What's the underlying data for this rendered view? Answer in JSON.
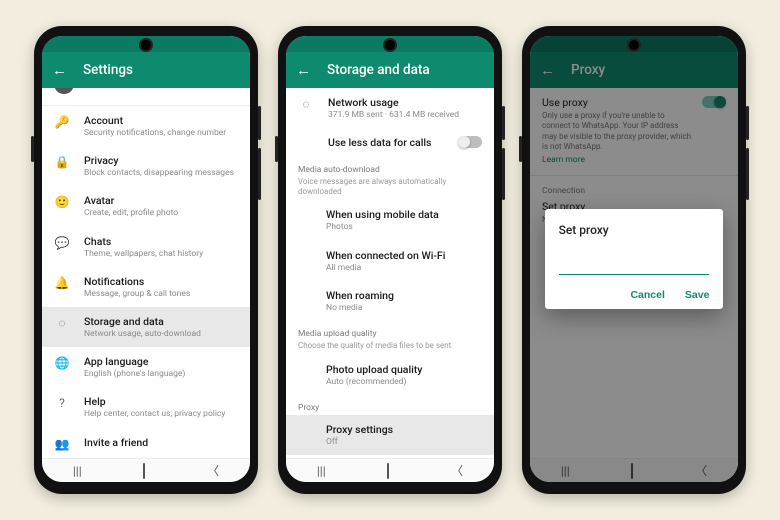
{
  "accent": "#0e8a6f",
  "phone1": {
    "title": "Settings",
    "items": [
      {
        "icon": "🔑",
        "label": "Account",
        "sub": "Security notifications, change number"
      },
      {
        "icon": "🔒",
        "label": "Privacy",
        "sub": "Block contacts, disappearing messages"
      },
      {
        "icon": "🙂",
        "label": "Avatar",
        "sub": "Create, edit, profile photo"
      },
      {
        "icon": "💬",
        "label": "Chats",
        "sub": "Theme, wallpapers, chat history"
      },
      {
        "icon": "🔔",
        "label": "Notifications",
        "sub": "Message, group & call tones"
      },
      {
        "icon": "◌",
        "label": "Storage and data",
        "sub": "Network usage, auto-download"
      },
      {
        "icon": "🌐",
        "label": "App language",
        "sub": "English (phone's language)"
      },
      {
        "icon": "?",
        "label": "Help",
        "sub": "Help center, contact us, privacy policy"
      },
      {
        "icon": "👥",
        "label": "Invite a friend",
        "sub": ""
      }
    ],
    "highlight_index": 5
  },
  "phone2": {
    "title": "Storage and data",
    "network": {
      "label": "Network usage",
      "sub": "371.9 MB sent · 631.4 MB received",
      "icon": "◌"
    },
    "lessdata_label": "Use less data for calls",
    "media_auto": {
      "header": "Media auto-download",
      "note": "Voice messages are always automatically downloaded",
      "items": [
        {
          "label": "When using mobile data",
          "sub": "Photos"
        },
        {
          "label": "When connected on Wi-Fi",
          "sub": "All media"
        },
        {
          "label": "When roaming",
          "sub": "No media"
        }
      ]
    },
    "upload": {
      "header": "Media upload quality",
      "note": "Choose the quality of media files to be sent",
      "item": {
        "label": "Photo upload quality",
        "sub": "Auto (recommended)"
      }
    },
    "proxy": {
      "header": "Proxy",
      "label": "Proxy settings",
      "sub": "Off"
    }
  },
  "phone3": {
    "title": "Proxy",
    "useproxy": {
      "label": "Use proxy",
      "desc": "Only use a proxy if you're unable to connect to WhatsApp. Your IP address may be visible to the proxy provider, which is not WhatsApp.",
      "learn": "Learn more"
    },
    "connection_header": "Connection",
    "setproxy": {
      "label": "Set proxy",
      "sub": "Not Set"
    },
    "dialog": {
      "title": "Set proxy",
      "cancel": "Cancel",
      "save": "Save",
      "placeholder": ""
    }
  }
}
